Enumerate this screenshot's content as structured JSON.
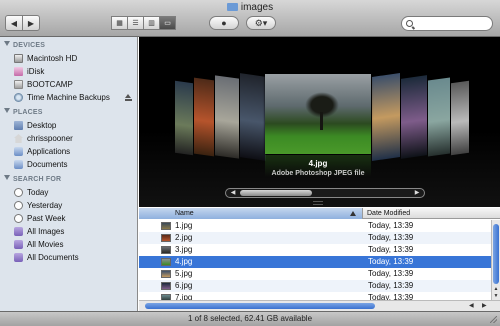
{
  "window": {
    "title": "images"
  },
  "toolbar": {
    "back_icon": "◀",
    "forward_icon": "▶",
    "view_icons": [
      "▦",
      "☰",
      "▥",
      "▭"
    ],
    "quicklook_icon": "●",
    "action_icon": "⚙▾",
    "search_placeholder": ""
  },
  "sidebar": {
    "devices": {
      "title": "DEVICES",
      "items": [
        {
          "label": "Macintosh HD",
          "icon": "hard-drive-icon"
        },
        {
          "label": "iDisk",
          "icon": "idisk-icon"
        },
        {
          "label": "BOOTCAMP",
          "icon": "volume-icon"
        },
        {
          "label": "Time Machine Backups",
          "icon": "time-machine-icon"
        }
      ]
    },
    "places": {
      "title": "PLACES",
      "items": [
        {
          "label": "Desktop",
          "icon": "desktop-icon"
        },
        {
          "label": "chrisspooner",
          "icon": "home-icon"
        },
        {
          "label": "Applications",
          "icon": "applications-icon"
        },
        {
          "label": "Documents",
          "icon": "documents-icon"
        }
      ]
    },
    "search_for": {
      "title": "SEARCH FOR",
      "items": [
        {
          "label": "Today",
          "icon": "clock-icon"
        },
        {
          "label": "Yesterday",
          "icon": "clock-icon"
        },
        {
          "label": "Past Week",
          "icon": "clock-icon"
        },
        {
          "label": "All Images",
          "icon": "smart-folder-icon"
        },
        {
          "label": "All Movies",
          "icon": "smart-folder-icon"
        },
        {
          "label": "All Documents",
          "icon": "smart-folder-icon"
        }
      ]
    }
  },
  "coverflow": {
    "selected_name": "4.jpg",
    "selected_kind": "Adobe Photoshop JPEG file"
  },
  "list": {
    "columns": {
      "name": "Name",
      "date": "Date Modified"
    },
    "rows": [
      {
        "name": "1.jpg",
        "date": "Today, 13:39",
        "selected": false
      },
      {
        "name": "2.jpg",
        "date": "Today, 13:39",
        "selected": false
      },
      {
        "name": "3.jpg",
        "date": "Today, 13:39",
        "selected": false
      },
      {
        "name": "4.jpg",
        "date": "Today, 13:39",
        "selected": true
      },
      {
        "name": "5.jpg",
        "date": "Today, 13:39",
        "selected": false
      },
      {
        "name": "6.jpg",
        "date": "Today, 13:39",
        "selected": false
      },
      {
        "name": "7.jpg",
        "date": "Today, 13:39",
        "selected": false
      }
    ]
  },
  "status": {
    "text": "1 of 8 selected, 62.41 GB available"
  },
  "colors": {
    "selection": "#3875d7",
    "sidebar_bg": "#dde4ec"
  }
}
